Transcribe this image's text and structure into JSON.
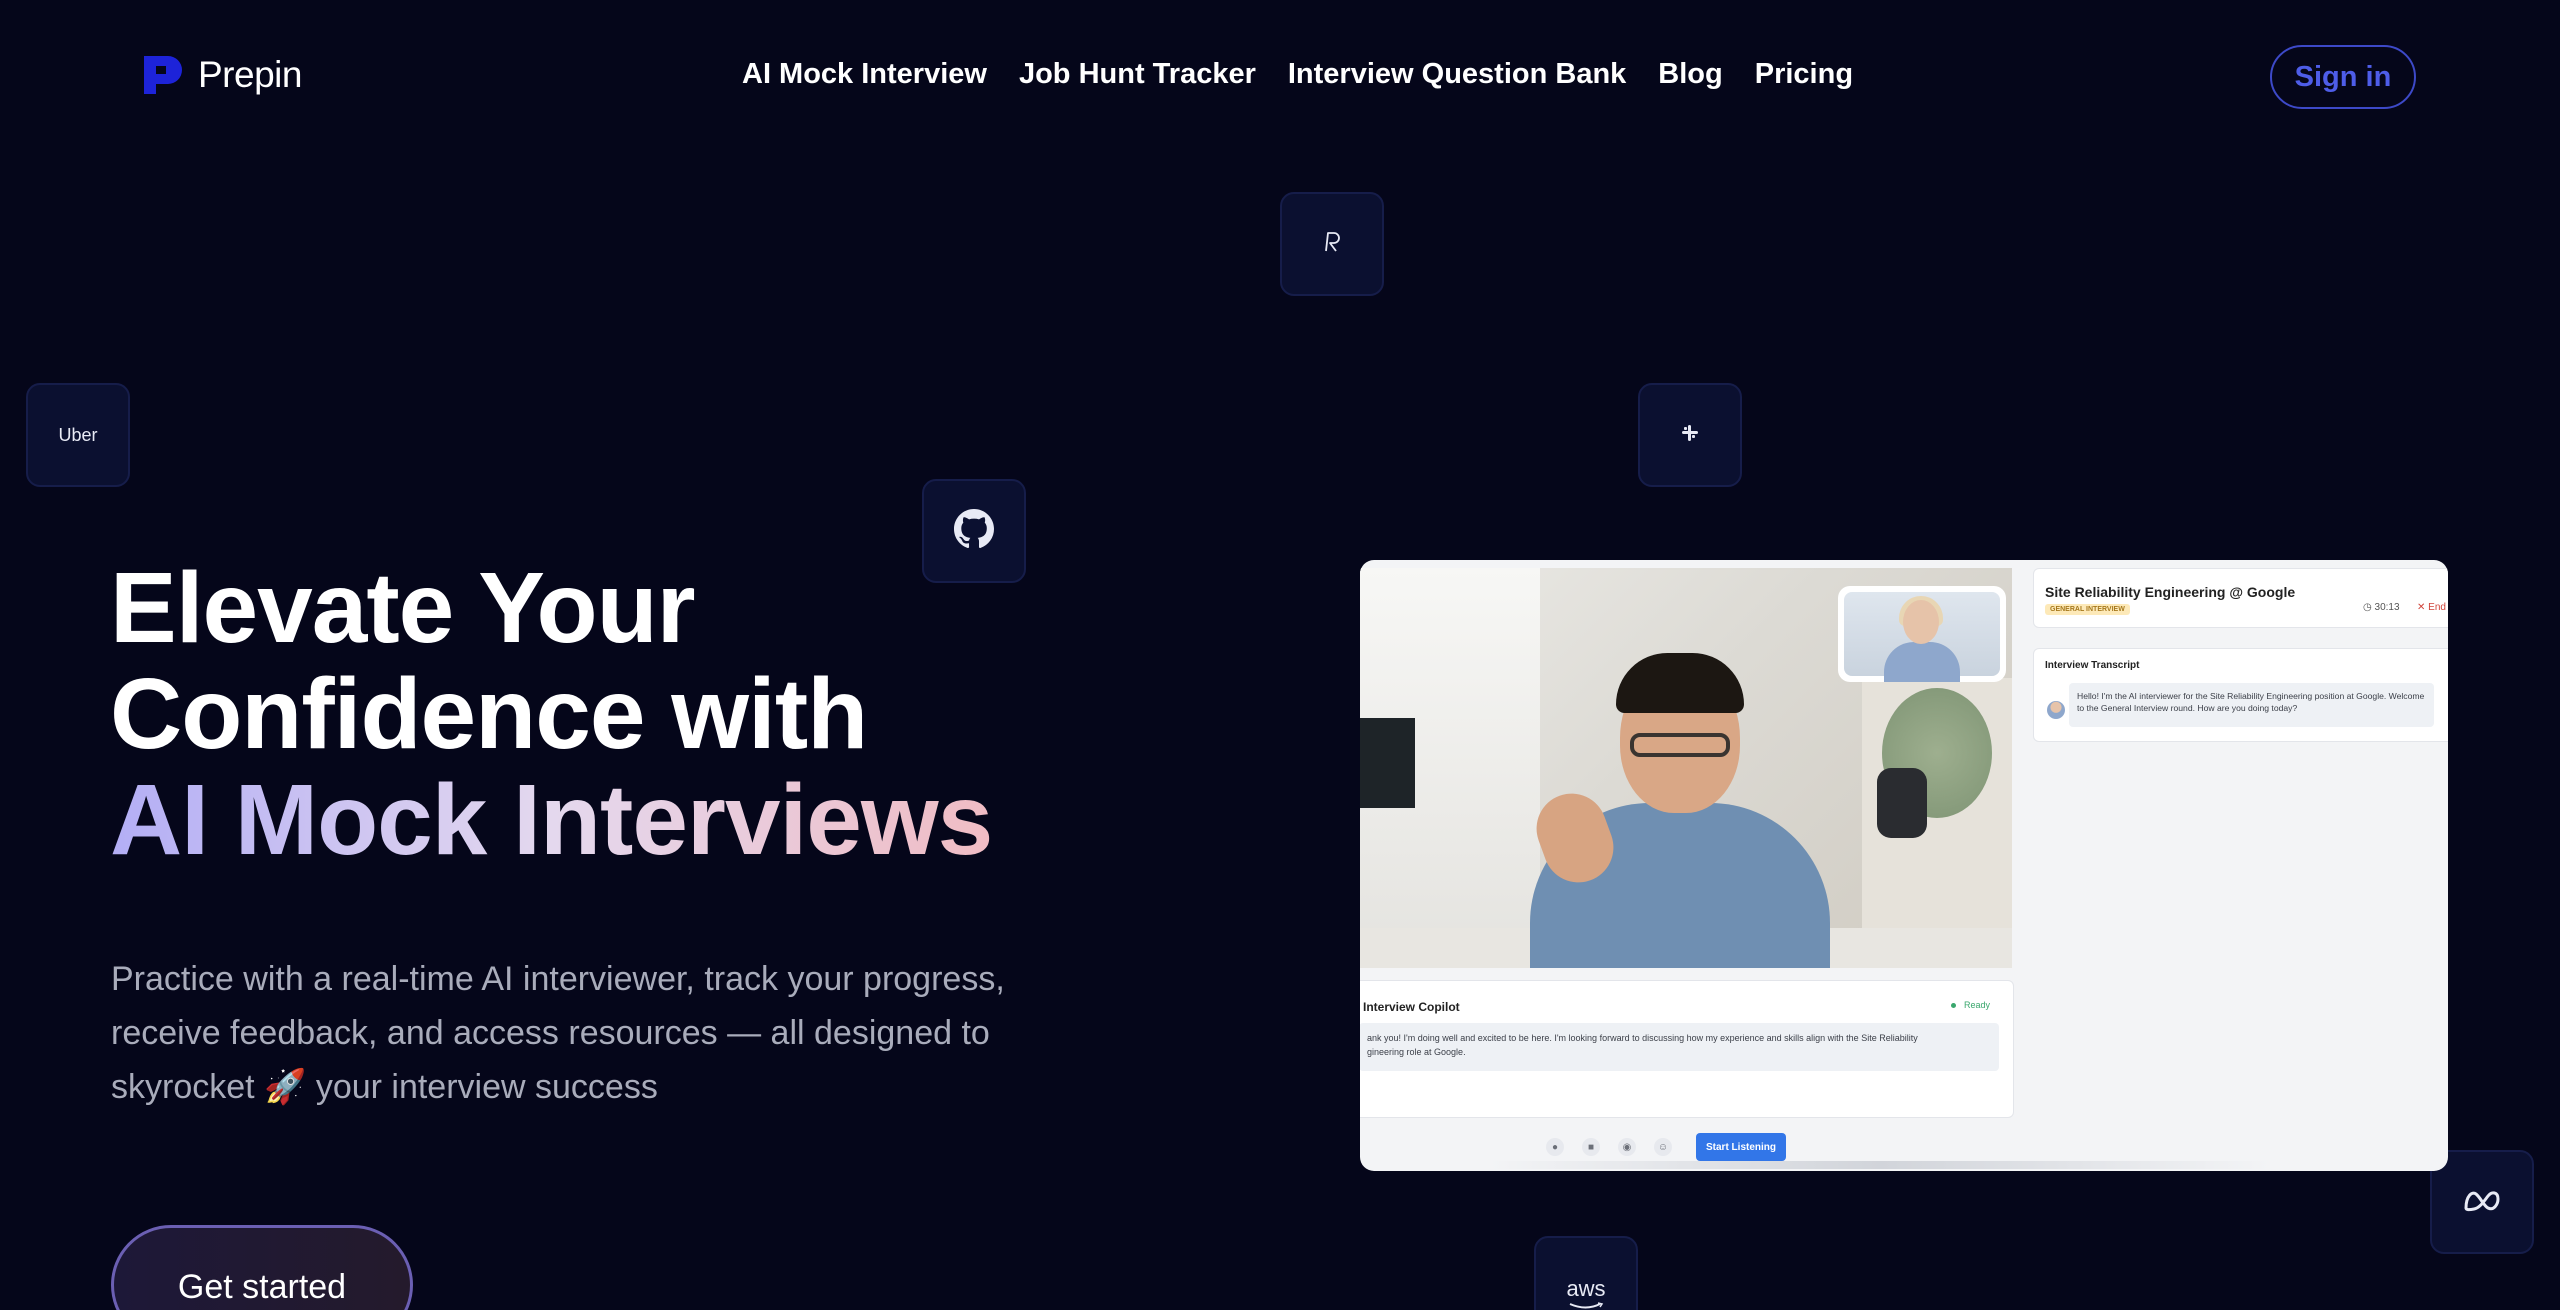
{
  "brand": {
    "name": "Prepin",
    "accent": "#1d23d9"
  },
  "nav": {
    "items": [
      {
        "label": "AI Mock Interview"
      },
      {
        "label": "Job Hunt Tracker"
      },
      {
        "label": "Interview Question Bank"
      },
      {
        "label": "Blog"
      },
      {
        "label": "Pricing"
      }
    ],
    "signin_label": "Sign in"
  },
  "tiles": {
    "uber_label": "Uber",
    "aws_label": "aws",
    "icons": [
      "revolut-icon",
      "uber-logo",
      "github-icon",
      "slack-icon",
      "meta-icon",
      "aws-logo"
    ]
  },
  "hero": {
    "title_line1": "Elevate Your",
    "title_line2": "Confidence with",
    "title_line3": "AI Mock Interviews",
    "subtitle_line1": "Practice with a real-time AI interviewer, track your progress,",
    "subtitle_line2": "receive feedback, and access resources — all designed to",
    "subtitle_line3": "skyrocket 🚀 your interview success",
    "cta_label": "Get started"
  },
  "preview": {
    "job_title": "Site Reliability Engineering @ Google",
    "badge": "GENERAL INTERVIEW",
    "timer": "30:13",
    "end_label": "End C",
    "transcript_title": "Interview Transcript",
    "transcript_text": "Hello! I'm the AI interviewer for the Site Reliability Engineering position at Google. Welcome to the General Interview round. How are you doing today?",
    "copilot_title": "Interview Copilot",
    "copilot_status": "Ready",
    "copilot_line1": "ank you! I'm doing well and excited to be here. I'm looking forward to discussing how my experience and skills align with the Site Reliability",
    "copilot_line2": "gineering role at Google.",
    "start_label": "Start Listening"
  }
}
